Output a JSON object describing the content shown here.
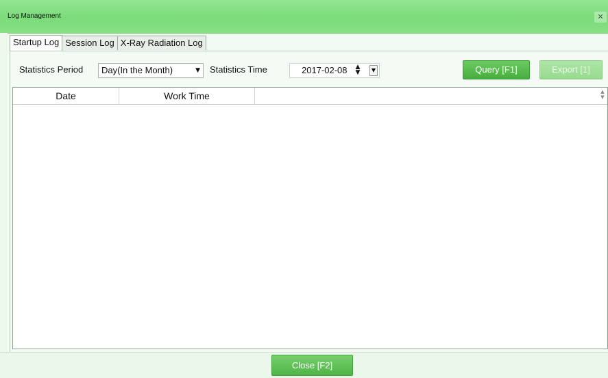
{
  "window": {
    "title": "Log Management",
    "close_glyph": "✕"
  },
  "tabs": [
    {
      "label": "Startup Log",
      "active": true
    },
    {
      "label": "Session Log",
      "active": false
    },
    {
      "label": "X-Ray Radiation Log",
      "active": false
    }
  ],
  "filters": {
    "period_label": "Statistics Period",
    "period_value": "Day(In the Month)",
    "time_label": "Statistics Time",
    "time_value": "2017-02-08"
  },
  "buttons": {
    "query_label": "Query [F1]",
    "export_label": "Export [1]",
    "close_label": "Close [F2]"
  },
  "table": {
    "columns": [
      "Date",
      "Work Time"
    ],
    "rows": []
  },
  "icons": {
    "dropdown": "chevron-down-icon",
    "spin": "spin-updown-icon",
    "close": "close-icon"
  },
  "colors": {
    "title_bar": "#7cdb7a",
    "primary_button": "#47ad3e",
    "disabled_button": "#97da8f"
  }
}
